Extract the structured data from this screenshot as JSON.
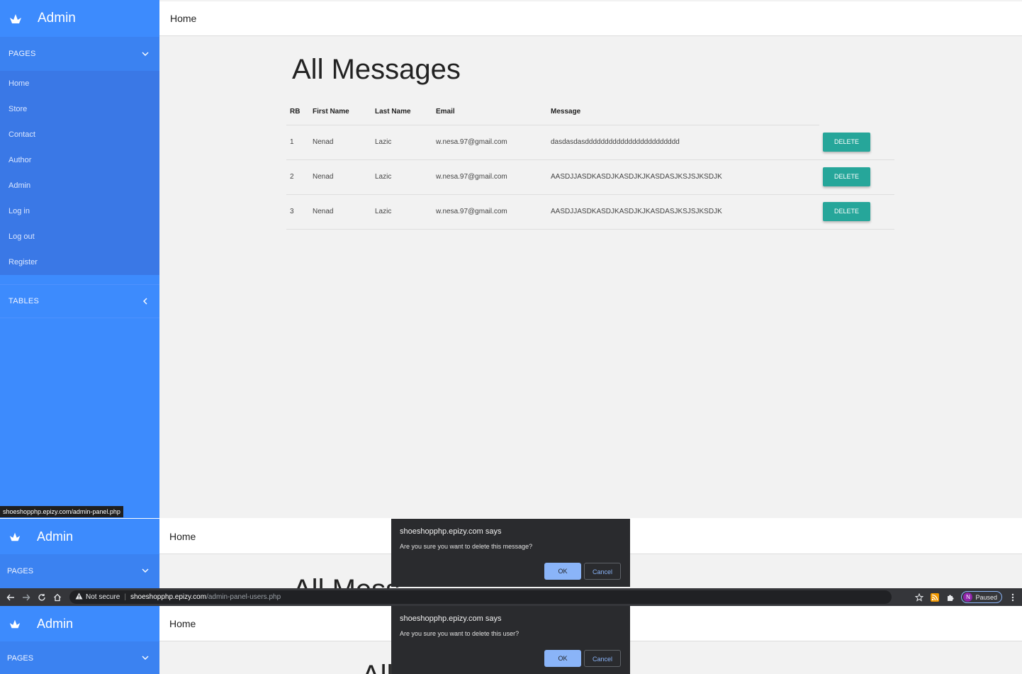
{
  "brand": "Admin",
  "sidebar": {
    "pages_label": "PAGES",
    "tables_label": "TABLES",
    "items": [
      "Home",
      "Store",
      "Contact",
      "Author",
      "Admin",
      "Log in",
      "Log out",
      "Register"
    ]
  },
  "topbar": {
    "title": "Home"
  },
  "status_url": "shoeshopphp.epizy.com/admin-panel.php",
  "messages": {
    "title": "All Messages",
    "columns": [
      "RB",
      "First Name",
      "Last Name",
      "Email",
      "Message"
    ],
    "delete_label": "DELETE",
    "rows": [
      {
        "rb": "1",
        "first": "Nenad",
        "last": "Lazic",
        "email": "w.nesa.97@gmail.com",
        "message": "dasdasdasdddddddddddddddddddddddd"
      },
      {
        "rb": "2",
        "first": "Nenad",
        "last": "Lazic",
        "email": "w.nesa.97@gmail.com",
        "message": "AASDJJASDKASDJKASDJKJKASDASJKSJSJKSDJK"
      },
      {
        "rb": "3",
        "first": "Nenad",
        "last": "Lazic",
        "email": "w.nesa.97@gmail.com",
        "message": "AASDJJASDKASDJKASDJKJKASDASJKSJSJKSDJK"
      }
    ]
  },
  "dialog_message": {
    "title": "shoeshopphp.epizy.com says",
    "text": "Are you sure you want to delete this message?",
    "ok": "OK",
    "cancel": "Cancel"
  },
  "dialog_user": {
    "title": "shoeshopphp.epizy.com says",
    "text": "Are you sure you want to delete this user?",
    "ok": "OK",
    "cancel": "Cancel"
  },
  "peek_title_1": "All Mess",
  "peek_title_2": "All",
  "browser": {
    "not_secure": "Not secure",
    "host": "shoeshopphp.epizy.com",
    "path": "/admin-panel-users.php",
    "profile_initial": "N",
    "profile_status": "Paused"
  },
  "colors": {
    "sidebar": "#3d8bfd",
    "delete_button": "#26a69a",
    "dialog_bg": "#2a2b2e",
    "dialog_ok": "#8ab4f8"
  },
  "icons": [
    "brand-logo-icon",
    "chevron-down-icon",
    "chevron-left-icon",
    "back-arrow-icon",
    "forward-arrow-icon",
    "reload-icon",
    "home-icon",
    "warning-icon",
    "star-icon",
    "rss-icon",
    "puzzle-icon",
    "kebab-menu-icon"
  ]
}
